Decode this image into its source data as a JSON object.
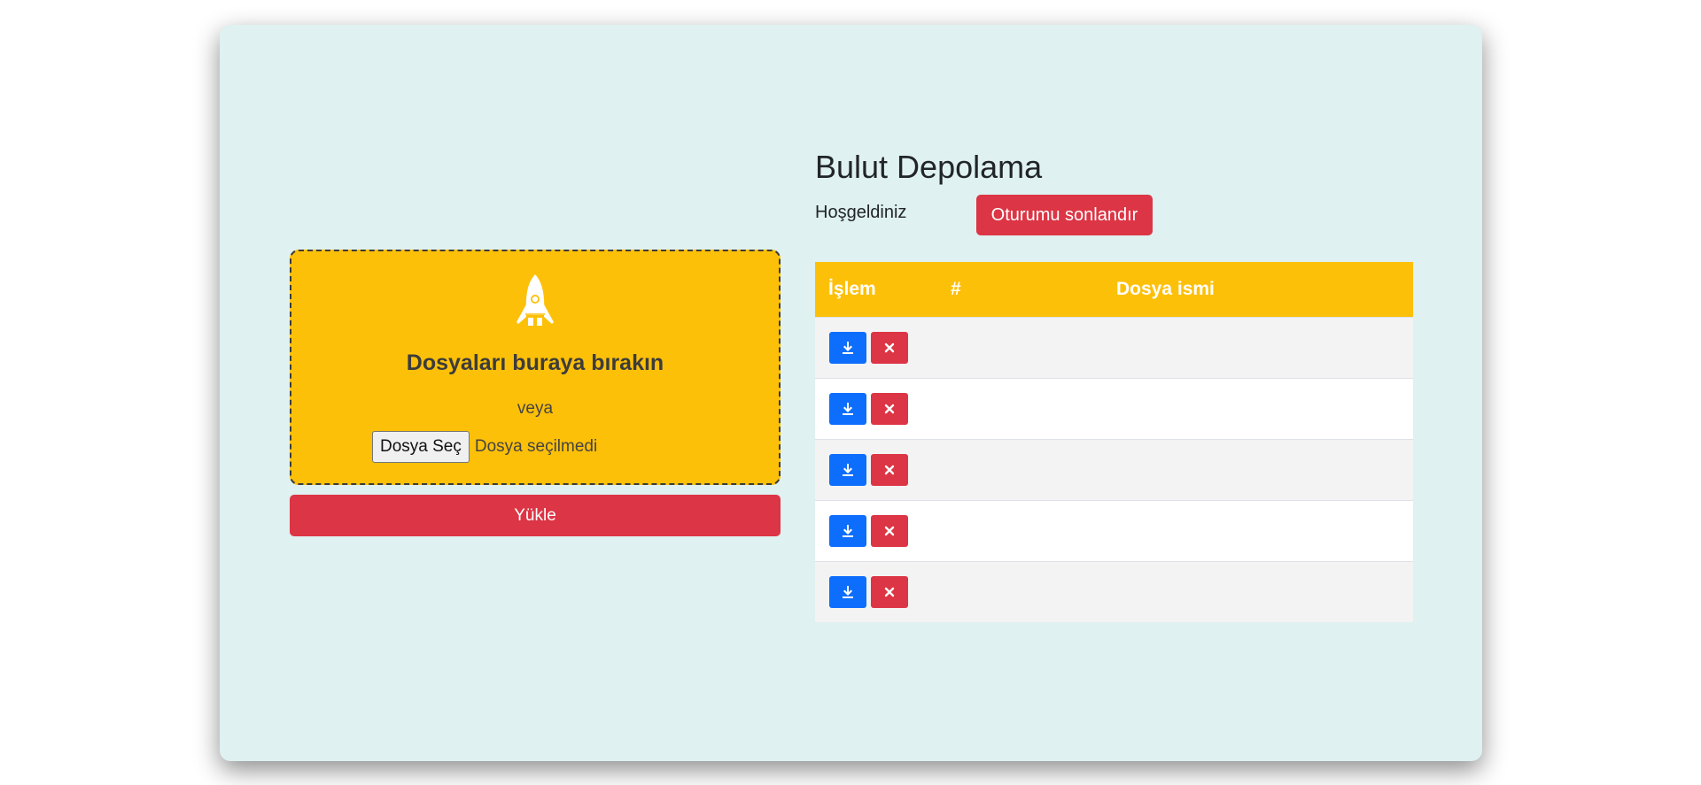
{
  "upload": {
    "drop_title": "Dosyaları buraya bırakın",
    "or_text": "veya",
    "choose_file_label": "Dosya Seç",
    "no_file_text": "Dosya seçilmedi",
    "upload_label": "Yükle"
  },
  "header": {
    "title": "Bulut Depolama",
    "welcome": "Hoşgeldiniz",
    "logout_label": "Oturumu sonlandır"
  },
  "table": {
    "columns": [
      "İşlem",
      "#",
      "Dosya ismi"
    ],
    "rows": [
      {
        "num": "",
        "name": ""
      },
      {
        "num": "",
        "name": ""
      },
      {
        "num": "",
        "name": ""
      },
      {
        "num": "",
        "name": ""
      },
      {
        "num": "",
        "name": ""
      }
    ]
  },
  "icons": {
    "upload": "rocket-icon",
    "download": "download-icon",
    "delete": "close-icon"
  },
  "colors": {
    "card_bg": "#dff1f0",
    "accent_yellow": "#fdc008",
    "danger": "#dc3545",
    "primary": "#0d6efd"
  }
}
